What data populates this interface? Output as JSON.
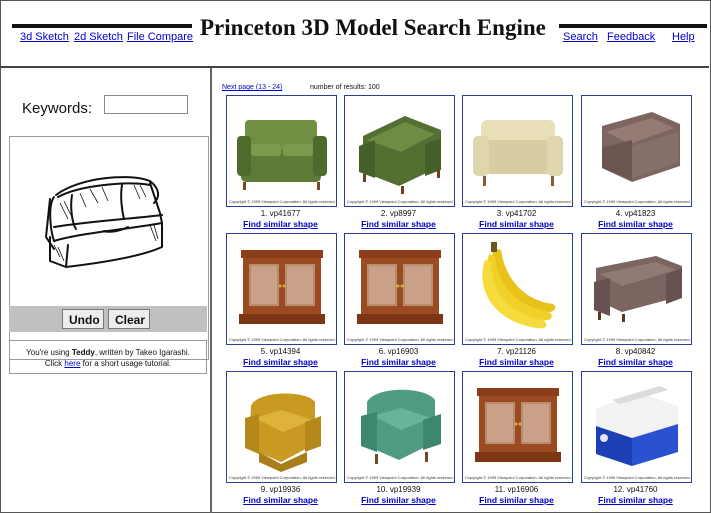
{
  "header": {
    "nav_left": [
      "3d Sketch",
      "2d Sketch",
      "File Compare"
    ],
    "title": "Princeton 3D Model Search Engine",
    "nav_right": [
      "Search",
      "Feedback",
      "Help"
    ]
  },
  "search": {
    "keywords_label": "Keywords:",
    "keywords_value": ""
  },
  "sketch": {
    "undo_label": "Undo",
    "clear_label": "Clear",
    "teddy_prefix": "You're using ",
    "teddy_name": "Teddy",
    "teddy_mid": ", written by Takeo Igarashi.",
    "teddy_click": "Click ",
    "teddy_here": "here",
    "teddy_suffix": " for a short usage tutorial."
  },
  "results": {
    "next_page": "Next page (13 - 24)",
    "count_text": "number of results: 100",
    "find_label": "Find similar shape",
    "copyright": "Copyright © 1999 Viewpoint Corporation. All rights reserved.",
    "items": [
      {
        "num": "1.",
        "id": "vp41677",
        "icon": "green-sofa"
      },
      {
        "num": "2.",
        "id": "vp8997",
        "icon": "green-loveseat"
      },
      {
        "num": "3.",
        "id": "vp41702",
        "icon": "cream-loveseat"
      },
      {
        "num": "4.",
        "id": "vp41823",
        "icon": "mauve-armchair"
      },
      {
        "num": "5.",
        "id": "vp14394",
        "icon": "wood-cabinet"
      },
      {
        "num": "6.",
        "id": "vp16903",
        "icon": "wood-cabinet"
      },
      {
        "num": "7.",
        "id": "vp21126",
        "icon": "banana-bunch"
      },
      {
        "num": "8.",
        "id": "vp40842",
        "icon": "mauve-loveseat"
      },
      {
        "num": "9.",
        "id": "vp19936",
        "icon": "yellow-armchair"
      },
      {
        "num": "10.",
        "id": "vp19939",
        "icon": "teal-armchair"
      },
      {
        "num": "11.",
        "id": "vp16906",
        "icon": "wood-cabinet"
      },
      {
        "num": "12.",
        "id": "vp41760",
        "icon": "cooler"
      }
    ]
  },
  "colors": {
    "link": "#0000cc",
    "thumb_border": "#2a3d9c",
    "button_bar": "#c0c0c0"
  }
}
